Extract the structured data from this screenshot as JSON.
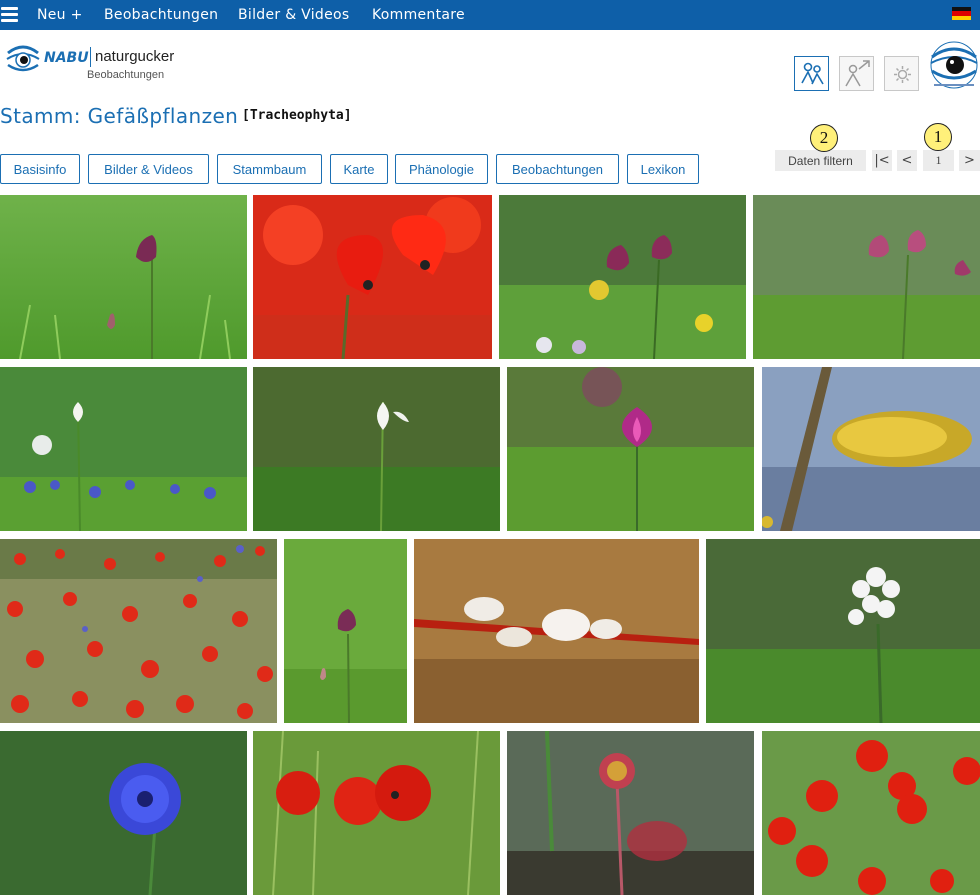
{
  "topbar": {
    "menu_icon": "hamburger-menu-icon",
    "items": [
      "Neu +",
      "Beobachtungen",
      "Bilder & Videos",
      "Kommentare"
    ],
    "language_icon": "german-flag-icon"
  },
  "logo": {
    "brand": "NABU",
    "name": "naturgucker",
    "subtitle": "Beobachtungen"
  },
  "header_icons": [
    "people-icon",
    "person-share-icon",
    "settings-icon",
    "naturgucker-eye-logo"
  ],
  "page": {
    "title": "Stamm: Gefäßpflanzen",
    "scientific_name": "[Tracheophyta]"
  },
  "tabs": [
    "Basisinfo",
    "Bilder & Videos",
    "Stammbaum",
    "Karte",
    "Phänologie",
    "Beobachtungen",
    "Lexikon"
  ],
  "pager": {
    "filter_label": "Daten filtern",
    "first": "|<",
    "prev": "<",
    "page": "1",
    "next": ">"
  },
  "markers": [
    "1",
    "2"
  ],
  "photos": [
    "fritillary-photo",
    "poppies-photo",
    "fritillaries-photo",
    "fritillaries-photo",
    "snowflake-photo",
    "snowdrop-photo",
    "iris-photo",
    "willow-catkin-photo",
    "poppy-field-photo",
    "fritillary-photo",
    "pussy-willow-photo",
    "white-hyacinth-photo",
    "cornflower-photo",
    "poppies-photo",
    "sundew-photo",
    "poppies-photo"
  ],
  "colors": {
    "brand_blue": "#0e5fa8",
    "link_blue": "#1b6fb3",
    "marker_yellow": "#fff07a"
  }
}
